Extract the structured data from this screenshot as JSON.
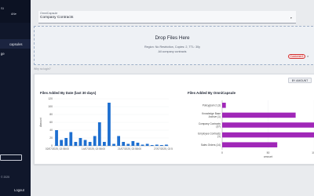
{
  "sidebar": {
    "logo": "SI",
    "user": "AN",
    "items": [
      {
        "label": "capsules"
      },
      {
        "label": "ge"
      }
    ],
    "version": "Why no login?",
    "logout_label": "Logout"
  },
  "selector": {
    "label": "OmniCapsule",
    "value": "Company Contracts"
  },
  "dropzone": {
    "title": "Drop Files Here",
    "line1": "Region: No Restriction, Copies: 2, TTL: 30y",
    "line2": "All company contracts",
    "chip": "Customer1"
  },
  "why_label": "Why no login?",
  "sort_button": "BY AMOUNT",
  "colors": {
    "bar_blue": "#1e6fd0",
    "bar_purple": "#a027b8",
    "sidebar_bg": "#10172b",
    "chip_red": "#d32f2f"
  },
  "chart_data": [
    {
      "type": "bar",
      "title": "Files Added By Date (last 30 days)",
      "ylabel": "Amount",
      "ylim": [
        0,
        120
      ],
      "yticks": [
        0,
        20,
        40,
        60,
        80,
        100,
        120
      ],
      "xtick_labels": [
        "02/07/2025, 02:58:00",
        "14/07/2025, 02:58:00",
        "21/07/2025, 02:58:00",
        "27/07/2025, 02:58:00"
      ],
      "values": [
        40,
        15,
        20,
        35,
        10,
        20,
        15,
        10,
        25,
        60,
        10,
        110,
        5,
        25,
        10,
        5,
        12,
        8,
        3,
        5,
        2,
        3,
        2,
        3
      ]
    },
    {
      "type": "bar",
      "orientation": "horizontal",
      "title": "Files Added By OmniCapsule",
      "xlabel": "amount",
      "xlim": [
        0,
        100
      ],
      "xticks": [
        0,
        50,
        100
      ],
      "categories": [
        "Policygram 2 (3)",
        "Knowledge Base Archive (1)",
        "Company Contracts (37)",
        "Employee Contracts (1)",
        "Sales Orders (14)"
      ],
      "values": [
        4,
        80,
        100,
        120,
        60
      ]
    }
  ]
}
